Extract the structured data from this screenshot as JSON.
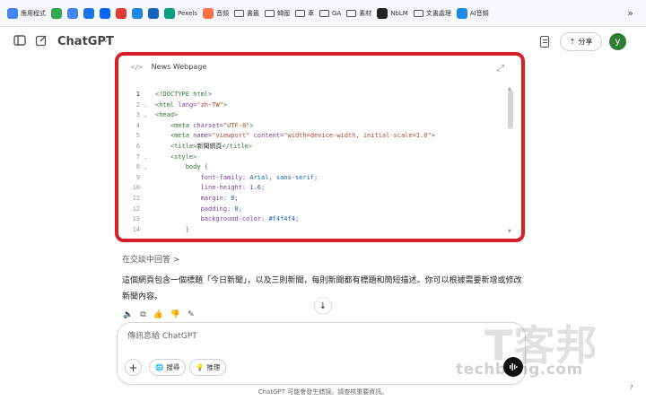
{
  "bookmarks": {
    "items": [
      {
        "label": "應用程式",
        "icon": "apps-grid-icon",
        "color": "#4285f4"
      },
      {
        "label": "",
        "icon": "puzzle-icon",
        "color": "#34a853"
      },
      {
        "label": "",
        "icon": "docs-icon",
        "color": "#4285f4"
      },
      {
        "label": "",
        "icon": "c-logo-icon",
        "color": "#1a73e8"
      },
      {
        "label": "",
        "icon": "meta-icon",
        "color": "#0866ff"
      },
      {
        "label": "",
        "icon": "trend-icon",
        "color": "#e53935"
      },
      {
        "label": "",
        "icon": "s-circle-icon",
        "color": "#1e88e5"
      },
      {
        "label": "",
        "icon": "image-icon",
        "color": "#1565c0"
      },
      {
        "label": "Pexels",
        "icon": "pexels-icon",
        "color": "#05a081"
      },
      {
        "label": "音頻",
        "icon": "audio-icon",
        "color": "#ff7043"
      },
      {
        "label": "書籤",
        "icon": "folder-icon"
      },
      {
        "label": "韓國",
        "icon": "folder-icon"
      },
      {
        "label": "車",
        "icon": "folder-icon"
      },
      {
        "label": "GA",
        "icon": "folder-icon"
      },
      {
        "label": "素材",
        "icon": "folder-icon"
      },
      {
        "label": "NbLM",
        "icon": "nblm-icon",
        "color": "#222222"
      },
      {
        "label": "文書處理",
        "icon": "folder-icon"
      },
      {
        "label": "AI音頻",
        "icon": "ai-audio-icon",
        "color": "#1e88e5"
      }
    ],
    "more": "»"
  },
  "header": {
    "title": "ChatGPT",
    "share_label": "分享",
    "avatar_initial": "y"
  },
  "canvas": {
    "title": "News Webpage",
    "code_lines": [
      {
        "n": "1",
        "fold": "",
        "parts": [
          [
            "tag",
            "<!DOCTYPE html>"
          ]
        ]
      },
      {
        "n": "2",
        "fold": "v",
        "parts": [
          [
            "tag",
            "<html "
          ],
          [
            "attr",
            "lang="
          ],
          [
            "str",
            "\"zh-TW\""
          ],
          [
            "tag",
            ">"
          ]
        ]
      },
      {
        "n": "3",
        "fold": "v",
        "parts": [
          [
            "tag",
            "<head>"
          ]
        ]
      },
      {
        "n": "4",
        "fold": "",
        "parts": [
          [
            "plain",
            "    "
          ],
          [
            "tag",
            "<meta "
          ],
          [
            "attr",
            "charset="
          ],
          [
            "str",
            "\"UTF-8\""
          ],
          [
            "tag",
            ">"
          ]
        ]
      },
      {
        "n": "5",
        "fold": "",
        "parts": [
          [
            "plain",
            "    "
          ],
          [
            "tag",
            "<meta "
          ],
          [
            "attr",
            "name="
          ],
          [
            "str",
            "\"viewport\" "
          ],
          [
            "attr",
            "content="
          ],
          [
            "str",
            "\"width=device-width, initial-scale=1.0\""
          ],
          [
            "tag",
            ">"
          ]
        ]
      },
      {
        "n": "6",
        "fold": "",
        "parts": [
          [
            "plain",
            "    "
          ],
          [
            "tag",
            "<title>"
          ],
          [
            "plain",
            "新聞網頁"
          ],
          [
            "tag",
            "</title>"
          ]
        ]
      },
      {
        "n": "7",
        "fold": "v",
        "parts": [
          [
            "plain",
            "    "
          ],
          [
            "tag",
            "<style>"
          ]
        ]
      },
      {
        "n": "8",
        "fold": "v",
        "parts": [
          [
            "plain",
            "        "
          ],
          [
            "tag",
            "body {"
          ]
        ]
      },
      {
        "n": "9",
        "fold": "",
        "parts": [
          [
            "plain",
            "            "
          ],
          [
            "prop",
            "font-family: "
          ],
          [
            "val",
            "Arial, sans-serif;"
          ]
        ]
      },
      {
        "n": "10",
        "fold": "",
        "parts": [
          [
            "plain",
            "            "
          ],
          [
            "prop",
            "line-height: "
          ],
          [
            "val",
            "1.6;"
          ]
        ]
      },
      {
        "n": "11",
        "fold": "",
        "parts": [
          [
            "plain",
            "            "
          ],
          [
            "prop",
            "margin: "
          ],
          [
            "val",
            "0;"
          ]
        ]
      },
      {
        "n": "12",
        "fold": "",
        "parts": [
          [
            "plain",
            "            "
          ],
          [
            "prop",
            "padding: "
          ],
          [
            "val",
            "0;"
          ]
        ]
      },
      {
        "n": "13",
        "fold": "",
        "parts": [
          [
            "plain",
            "            "
          ],
          [
            "prop",
            "background-color: "
          ],
          [
            "val",
            "#f4f4f4;"
          ]
        ]
      },
      {
        "n": "14",
        "fold": "",
        "parts": [
          [
            "plain",
            "        "
          ],
          [
            "tag",
            "}"
          ]
        ]
      }
    ]
  },
  "chat": {
    "answer_link": "在交談中回答 >",
    "reply": "這個網頁包含一個標題「今日新聞」，以及三則新聞，每則新聞都有標題和簡短描述。你可以根據需要新增或修改新聞內容。",
    "scroll_down": "↓"
  },
  "composer": {
    "placeholder": "傳訊息給 ChatGPT",
    "search_label": "搜尋",
    "reason_label": "推理"
  },
  "footer": {
    "note": "ChatGPT 可能會發生錯誤。請查核重要資訊。",
    "help": "?"
  },
  "watermark": {
    "big": "T客邦",
    "small": "techbang.com"
  },
  "colors": {
    "highlight_frame": "#d81f26",
    "avatar": "#2f7d32"
  }
}
